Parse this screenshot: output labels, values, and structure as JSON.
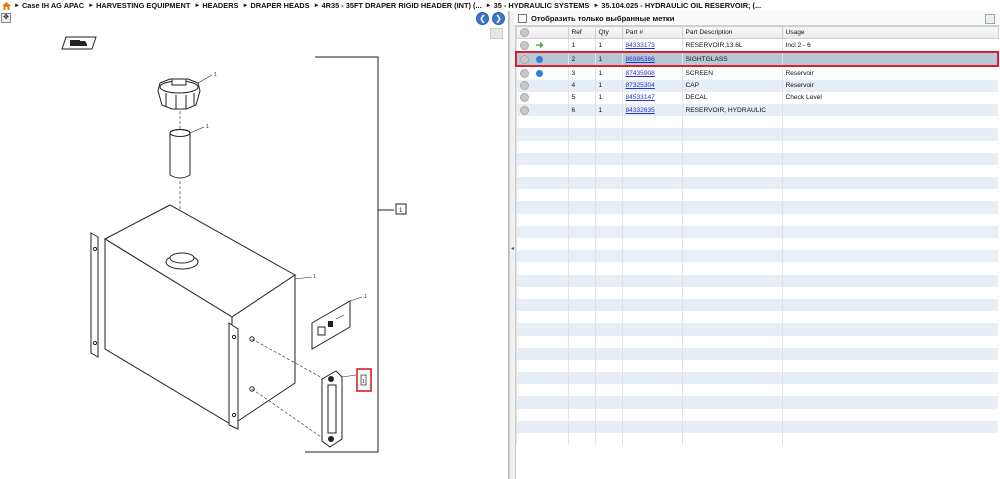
{
  "breadcrumb": {
    "items": [
      "Case IH AG APAC",
      "HARVESTING EQUIPMENT",
      "HEADERS",
      "DRAPER HEADS",
      "4R35 - 35FT DRAPER RIGID HEADER (INT) (...",
      "35 - HYDRAULIC SYSTEMS",
      "35.104.025 - HYDRAULIC OIL RESERVOIR; (..."
    ]
  },
  "diagram": {
    "callouts": [
      "1",
      "1",
      "1",
      "1",
      "1",
      "1",
      "1"
    ],
    "highlight_color": "#d9202a"
  },
  "filter": {
    "label": "Отобразить только выбранные метки",
    "checked": false
  },
  "table": {
    "columns": [
      "",
      "Ref",
      "Qty",
      "Part #",
      "Part Description",
      "Usage"
    ],
    "rows": [
      {
        "icon": "green-arrow-icon",
        "ref": "1",
        "qty": "1",
        "part": "84333173",
        "desc": "RESERVOIR,13.6L",
        "usage": "Incl 2 - 6"
      },
      {
        "icon": "blue-info-icon",
        "ref": "2",
        "qty": "1",
        "part": "86986366",
        "desc": "SIGHTGLASS",
        "usage": "",
        "selected": true
      },
      {
        "icon": "blue-info-icon",
        "ref": "3",
        "qty": "1",
        "part": "87435908",
        "desc": "SCREEN",
        "usage": "Reservoir"
      },
      {
        "icon": "",
        "ref": "4",
        "qty": "1",
        "part": "87325304",
        "desc": "CAP",
        "usage": "Reservoir"
      },
      {
        "icon": "",
        "ref": "5",
        "qty": "1",
        "part": "84533147",
        "desc": "DECAL",
        "usage": "Check Level"
      },
      {
        "icon": "",
        "ref": "6",
        "qty": "1",
        "part": "84332635",
        "desc": "RESERVOIR, HYDRAULIC",
        "usage": ""
      }
    ]
  }
}
